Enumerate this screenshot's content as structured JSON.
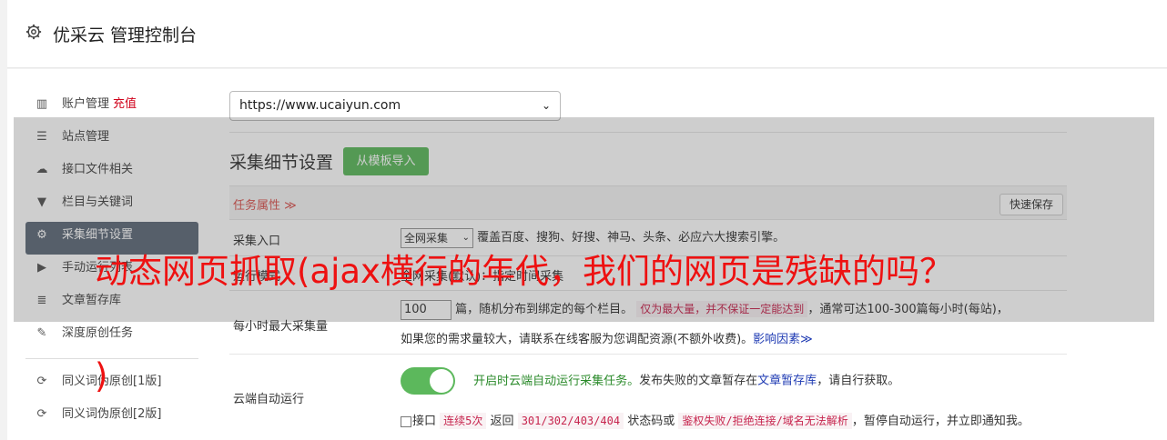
{
  "header": {
    "title": "优采云 管理控制台",
    "icon": "gear-icon"
  },
  "sidebar": {
    "items": [
      {
        "label": "账户管理",
        "badge": "充值",
        "icon": "bar-chart-icon"
      },
      {
        "label": "站点管理",
        "icon": "server-icon"
      },
      {
        "label": "接口文件相关",
        "icon": "cloud-download-icon"
      },
      {
        "label": "栏目与关键词",
        "icon": "filter-icon"
      },
      {
        "label": "采集细节设置",
        "icon": "gears-icon",
        "active": true
      },
      {
        "label": "手动运行列表",
        "icon": "play-circle-icon"
      },
      {
        "label": "文章暂存库",
        "icon": "database-icon"
      },
      {
        "label": "深度原创任务",
        "icon": "edit-icon"
      },
      {
        "label": "同义词伪原创[1版]",
        "icon": "refresh-icon"
      },
      {
        "label": "同义词伪原创[2版]",
        "icon": "refresh-icon"
      }
    ]
  },
  "main": {
    "site_select": "https://www.ucaiyun.com",
    "section_title": "采集细节设置",
    "template_button": "从模板导入",
    "prop_title": "任务属性 ≫",
    "quick_save": "快速保存",
    "rows": {
      "entry": {
        "label": "采集入口",
        "select": "全网采集",
        "desc": "覆盖百度、搜狗、好搜、神马、头条、必应六大搜索引擎。"
      },
      "mode": {
        "label": "运行模式",
        "desc": "全网采集(默认)：指定时间采集"
      },
      "hourly": {
        "label": "每小时最大采集量",
        "value": "100",
        "desc1": "篇，随机分布到绑定的每个栏目。",
        "tag1": "仅为最大量，并不保证一定能达到",
        "desc2": "，通常可达100-300篇每小时(每站)，",
        "desc3": "如果您的需求量较大，请联系在线客服为您调配资源(不额外收费)。",
        "link": "影响因素≫"
      },
      "cloud": {
        "label": "云端自动运行",
        "green_text": "开启时云端自动运行采集任务。",
        "desc1": "发布失败的文章暂存在",
        "link": "文章暂存库",
        "desc2": "，请自行获取。",
        "cb_label": "接口",
        "tag1": "连续5次",
        "desc3": "返回",
        "tag2": "301/302/403/404",
        "desc4": "状态码或",
        "tag3": "鉴权失败/拒绝连接/域名无法解析",
        "desc5": "，暂停自动运行，并立即通知我。"
      }
    }
  },
  "overlay_title": "动态网页抓取(ajax横行的年代，我们的网页是残缺的吗？",
  "overlay_title_tail": ")",
  "colors": {
    "accent_green": "#5cb85c",
    "active_sidebar": "#5f6b7a",
    "banner_red": "#ee1111",
    "warning_red": "#d0021b"
  }
}
